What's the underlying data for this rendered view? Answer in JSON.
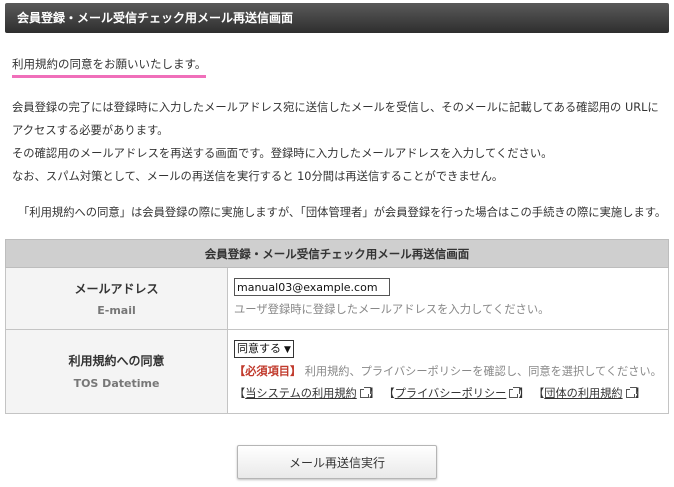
{
  "header": {
    "title": "会員登録・メール受信チェック用メール再送信画面"
  },
  "notice": {
    "agree": "利用規約の同意をお願いいたします。"
  },
  "description": [
    "会員登録の完了には登録時に入力したメールアドレス宛に送信したメールを受信し、そのメールに記載してある確認用の URLに",
    "アクセスする必要があります。",
    "その確認用のメールアドレスを再送する画面です。登録時に入力したメールアドレスを入力してください。",
    "なお、スパム対策として、メールの再送信を実行すると 10分間は再送信することができません。"
  ],
  "tos_note": "「利用規約への同意」は会員登録の際に実施しますが、「団体管理者」が会員登録を行った場合はこの手続きの際に実施します。",
  "form": {
    "caption": "会員登録・メール受信チェック用メール再送信画面",
    "email": {
      "label": "メールアドレス",
      "sublabel": "E-mail",
      "value": "manual03@example.com",
      "hint": "ユーザ登録時に登録したメールアドレスを入力してください。"
    },
    "tos": {
      "label": "利用規約への同意",
      "sublabel": "TOS Datetime",
      "selected": "同意する",
      "required": "【必須項目】",
      "required_text": "利用規約、プライバシーポリシーを確認し、同意を選択してください。",
      "links": [
        "当システムの利用規約",
        "プライバシーポリシー",
        "団体の利用規約"
      ]
    }
  },
  "submit": {
    "label": "メール再送信実行"
  }
}
